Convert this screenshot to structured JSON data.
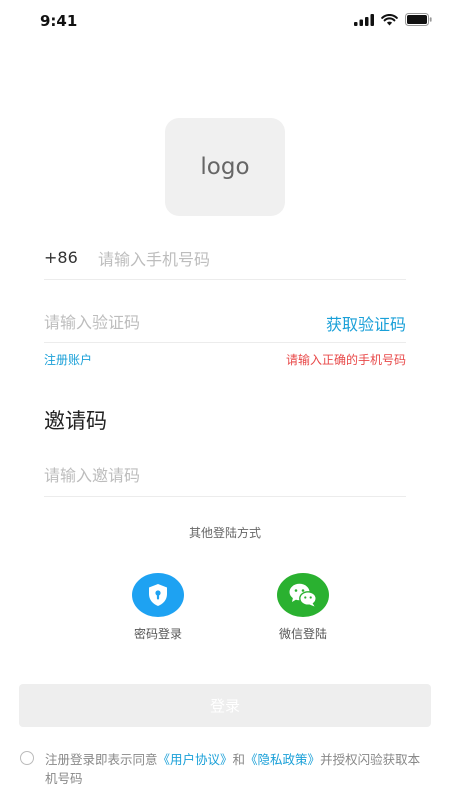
{
  "status_bar": {
    "time": "9:41"
  },
  "logo": {
    "text": "logo"
  },
  "phone": {
    "prefix": "+86",
    "placeholder": "请输入手机号码",
    "value": ""
  },
  "code": {
    "placeholder": "请输入验证码",
    "value": "",
    "get_code_label": "获取验证码"
  },
  "register_link": "注册账户",
  "error_message": "请输入正确的手机号码",
  "invite": {
    "title": "邀请码",
    "placeholder": "请输入邀请码",
    "value": ""
  },
  "other_methods": {
    "title": "其他登陆方式",
    "password_label": "密码登录",
    "wechat_label": "微信登陆"
  },
  "login_button": "登录",
  "agreement": {
    "prefix": "注册登录即表示同意",
    "user_agreement": "《用户协议》",
    "and": "和",
    "privacy_policy": "《隐私政策》",
    "suffix": "并授权闪验获取本机号码"
  },
  "colors": {
    "accent": "#1aa0d8",
    "error": "#e84848",
    "password_icon_bg": "#1ea2f2",
    "wechat_icon_bg": "#2ab130"
  }
}
